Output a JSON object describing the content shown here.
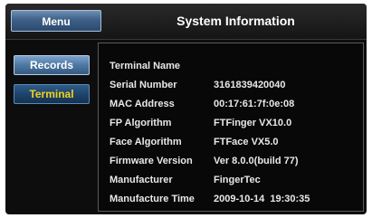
{
  "header": {
    "menu_label": "Menu",
    "title": "System Information"
  },
  "sidebar": {
    "items": [
      {
        "label": "Records",
        "selected": false
      },
      {
        "label": "Terminal",
        "selected": true
      }
    ],
    "selected_color": "#f2d21b"
  },
  "info": {
    "rows": [
      {
        "label": "Terminal Name",
        "value": ""
      },
      {
        "label": "Serial Number",
        "value": "3161839420040"
      },
      {
        "label": "MAC Address",
        "value": "00:17:61:7f:0e:08"
      },
      {
        "label": "FP Algorithm",
        "value": "FTFinger VX10.0"
      },
      {
        "label": "Face Algorithm",
        "value": "FTFace VX5.0"
      },
      {
        "label": "Firmware Version",
        "value": "Ver 8.0.0(build 77)"
      },
      {
        "label": "Manufacturer",
        "value": "FingerTec"
      },
      {
        "label": "Manufacture Time",
        "value": "2009-10-14  19:30:35"
      }
    ]
  }
}
